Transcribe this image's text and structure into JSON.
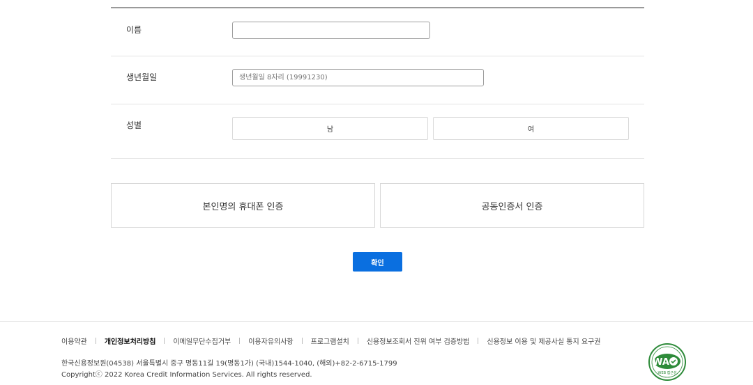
{
  "form": {
    "name_label": "이름",
    "name_value": "",
    "name_placeholder": "",
    "birth_label": "생년월일",
    "birth_placeholder": "생년월일 8자리 (19991230)",
    "gender_label": "성별",
    "gender_male": "남",
    "gender_female": "여"
  },
  "auth": {
    "phone_label": "본인명의 휴대폰 인증",
    "cert_label": "공동인증서 인증"
  },
  "confirm_label": "확인",
  "footer": {
    "links": [
      "이용약관",
      "개인정보처리방침",
      "이메일무단수집거부",
      "이용자유의사항",
      "프로그램설치",
      "신용정보조회서 진위 여부 검증방법",
      "신용정보 이용 및 제공사실 통지 요구권"
    ],
    "address": "한국신용정보원(04538) 서울특별시 중구 명동11길 19(명동1가) (국내)1544-1040, (해외)+82-2-6715-1799",
    "copyright": "Copyrightⓒ 2022 Korea Credit Information Services. All rights reserved.",
    "badge_text": "WA",
    "badge_sub": "WEB 접근성"
  },
  "colors": {
    "primary": "#0a6fe0",
    "badge_green": "#2e8b3a"
  }
}
